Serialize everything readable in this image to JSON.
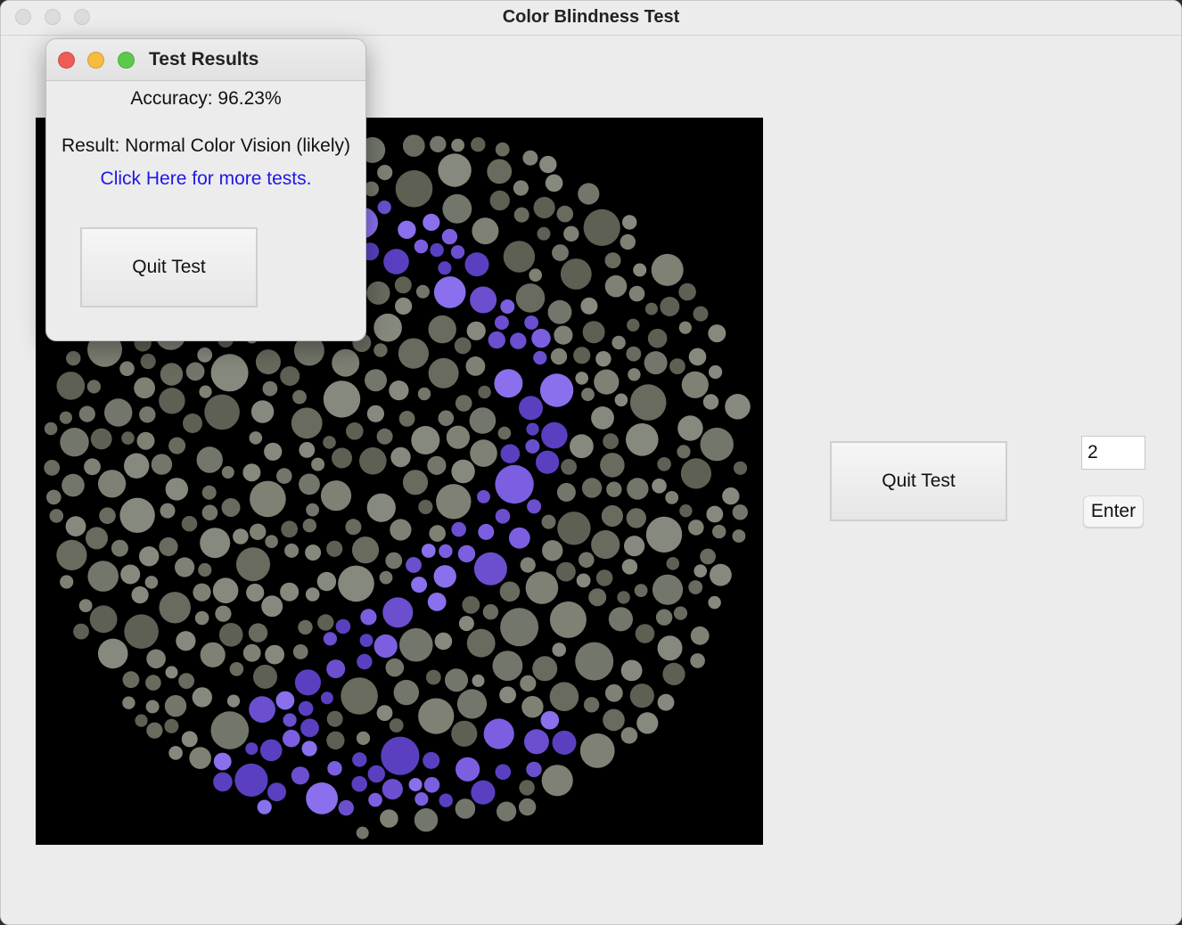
{
  "window": {
    "title": "Color Blindness Test"
  },
  "plate": {
    "background_color": "#000000",
    "figure_colors": [
      "#6b4fcf",
      "#7c5fe0",
      "#8a70ec",
      "#5a40c0"
    ],
    "background_dot_colors": [
      "#5e6054",
      "#73776b",
      "#868a7e",
      "#696b5f",
      "#7f8175"
    ]
  },
  "main": {
    "quit_label": "Quit Test",
    "answer_value": "2",
    "enter_label": "Enter"
  },
  "results_dialog": {
    "title": "Test Results",
    "accuracy": "Accuracy: 96.23%",
    "result": "Result: Normal Color Vision (likely)",
    "link": "Click Here for more tests.",
    "quit_label": "Quit Test",
    "traffic_colors": [
      "#ee5c55",
      "#f6bb3f",
      "#5bc94a"
    ]
  }
}
